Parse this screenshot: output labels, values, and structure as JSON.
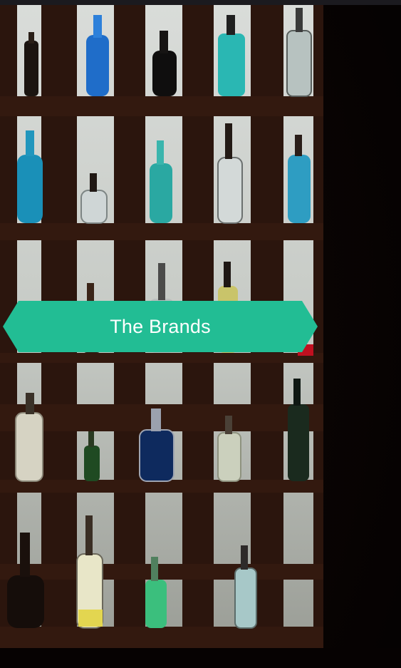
{
  "hero": {
    "banner_label": "The Brands"
  },
  "colors": {
    "accent": "#22bd94",
    "background": "#0a0404",
    "top_bar": "#1b1a1f",
    "shelf_wood": "#2a140c"
  }
}
